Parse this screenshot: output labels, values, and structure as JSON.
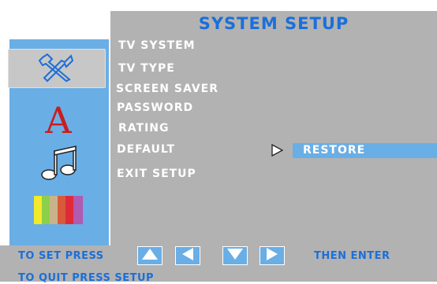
{
  "header": {
    "title": "SYSTEM SETUP"
  },
  "sidebar": {
    "icons": [
      "tools-icon",
      "font-icon",
      "music-note-icon",
      "color-bars-icon"
    ],
    "font_letter": "A"
  },
  "menu": {
    "items": [
      "TV SYSTEM",
      "TV TYPE",
      "SCREEN SAVER",
      "PASSWORD",
      "RATING",
      "DEFAULT",
      "EXIT SETUP"
    ],
    "selected": "DEFAULT",
    "submenu_value": "RESTORE"
  },
  "footer": {
    "set_label": "TO SET PRESS",
    "then_label": "THEN ENTER",
    "quit_label": "TO QUIT PRESS SETUP"
  },
  "colors": {
    "panel": "#b2b2b2",
    "accent_blue": "#1b6fd8",
    "sidebar_blue": "#6aaee6"
  }
}
